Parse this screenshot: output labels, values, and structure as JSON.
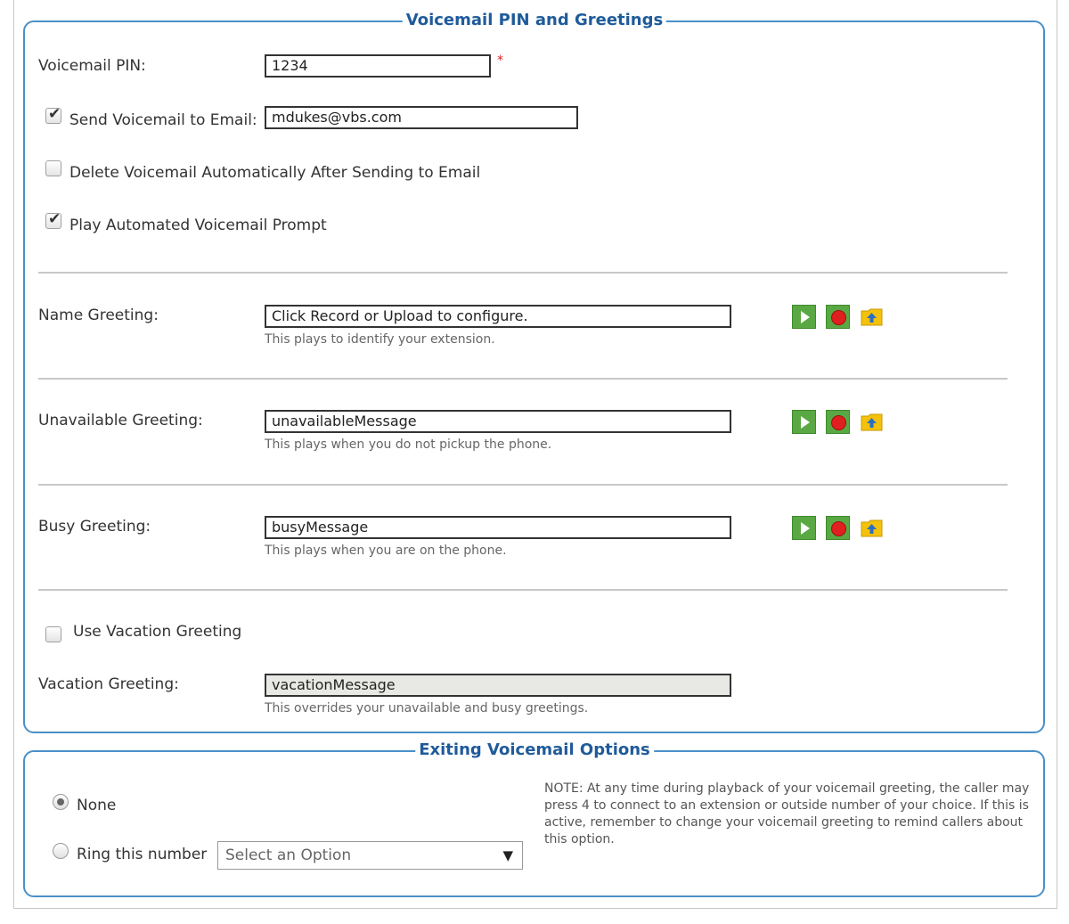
{
  "voicemail_section": {
    "title": "Voicemail PIN and Greetings",
    "pin_label": "Voicemail PIN:",
    "pin_value": "1234",
    "required_mark": "*",
    "send_email_label": "Send Voicemail to Email:",
    "send_email_checked": true,
    "email_value": "mdukes@vbs.com",
    "delete_auto_label": "Delete Voicemail Automatically After Sending to Email",
    "delete_auto_checked": false,
    "play_prompt_label": "Play Automated Voicemail Prompt",
    "play_prompt_checked": true,
    "name_greeting": {
      "label": "Name Greeting:",
      "value": "Click Record or Upload to configure.",
      "hint": "This plays to identify your extension."
    },
    "unavailable_greeting": {
      "label": "Unavailable Greeting:",
      "value": "unavailableMessage",
      "hint": "This plays when you do not pickup the phone."
    },
    "busy_greeting": {
      "label": "Busy Greeting:",
      "value": "busyMessage",
      "hint": "This plays when you are on the phone."
    },
    "use_vacation_label": "Use Vacation Greeting",
    "use_vacation_checked": false,
    "vacation_greeting": {
      "label": "Vacation Greeting:",
      "value": "vacationMessage",
      "hint": "This overrides your unavailable and busy greetings."
    },
    "icons": [
      "play-icon",
      "record-icon",
      "upload-folder-icon"
    ]
  },
  "exit_section": {
    "title": "Exiting Voicemail Options",
    "none_label": "None",
    "none_selected": true,
    "ring_label": "Ring this number",
    "ring_select_value": "Select an Option",
    "note": "NOTE: At any time during playback of your voicemail greeting, the caller may press 4 to connect to an extension or outside number of your choice. If this is active, remember to change your voicemail greeting to remind callers about this option."
  },
  "colors": {
    "accent": "#4a90c8",
    "legend_text": "#1f5b9a",
    "required": "#e02020",
    "play_green": "#5aa843",
    "upload_yellow": "#f4c20d"
  }
}
